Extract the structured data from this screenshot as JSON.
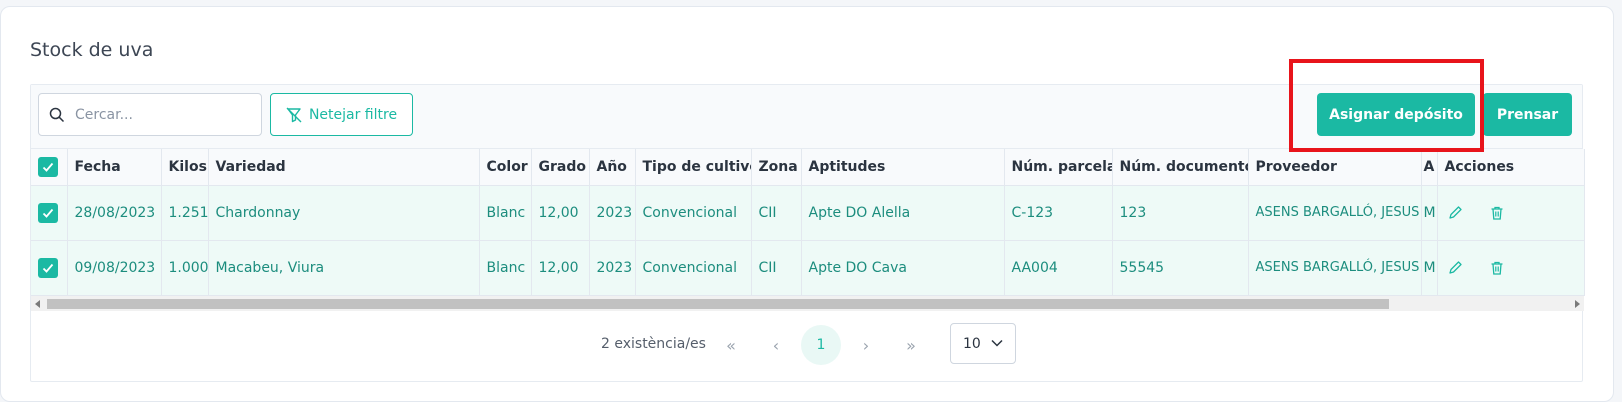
{
  "title": "Stock de uva",
  "toolbar": {
    "search_placeholder": "Cercar...",
    "clear_filter_label": "Netejar filtre",
    "assign_label": "Asignar depósito",
    "press_label": "Prensar"
  },
  "table": {
    "headers": [
      "Fecha",
      "Kilos",
      "Variedad",
      "Color",
      "Grado",
      "Año",
      "Tipo de cultivo",
      "Zona",
      "Aptitudes",
      "Núm. parcela",
      "Núm. documento",
      "Proveedor",
      "A",
      "Acciones"
    ],
    "rows": [
      {
        "checked": true,
        "cells": [
          "28/08/2023",
          "1.251",
          "Chardonnay",
          "Blanc",
          "12,00",
          "2023",
          "Convencional",
          "CII",
          "Apte DO Alella",
          "C-123",
          "123",
          "ASENS BARGALLÓ, JESUS",
          "M"
        ]
      },
      {
        "checked": true,
        "cells": [
          "09/08/2023",
          "1.000",
          "Macabeu, Viura",
          "Blanc",
          "12,00",
          "2023",
          "Convencional",
          "CII",
          "Apte DO Cava",
          "AA004",
          "55545",
          "ASENS BARGALLÓ, JESUS",
          "M"
        ]
      }
    ]
  },
  "pagination": {
    "count_text": "2 existència/es",
    "first": "«",
    "prev": "‹",
    "current_page": "1",
    "next": "›",
    "last": "»",
    "page_size": "10"
  },
  "colors": {
    "accent": "#1bb9a3",
    "highlight": "#e8141b"
  }
}
